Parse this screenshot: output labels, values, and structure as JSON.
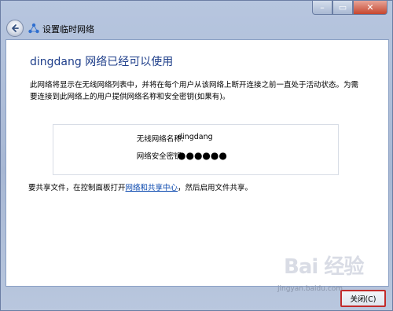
{
  "window": {
    "title": "设置临时网络",
    "caption": {
      "minimize": "–",
      "maximize": "▭",
      "close": "✕"
    }
  },
  "heading": "dingdang 网络已经可以使用",
  "description": "此网络将显示在无线网络列表中，并将在每个用户从该网络上断开连接之前一直处于活动状态。为需要连接到此网络上的用户提供网络名称和安全密钥(如果有)。",
  "network_info": {
    "name_label": "无线网络名称:",
    "name_value": "dingdang",
    "key_label": "网络安全密钥:",
    "key_value": "●●●●●●"
  },
  "share_text": {
    "before": "要共享文件，在控制面板打开",
    "link": "网络和共享中心",
    "after": "，然后启用文件共享。"
  },
  "buttons": {
    "close": "关闭(C)"
  },
  "watermark": {
    "logo": "Bai 经验",
    "url": "jingyan.baidu.com"
  },
  "colors": {
    "heading": "#1e3e8a",
    "link": "#0645ad",
    "close_highlight": "#c22b2b"
  }
}
